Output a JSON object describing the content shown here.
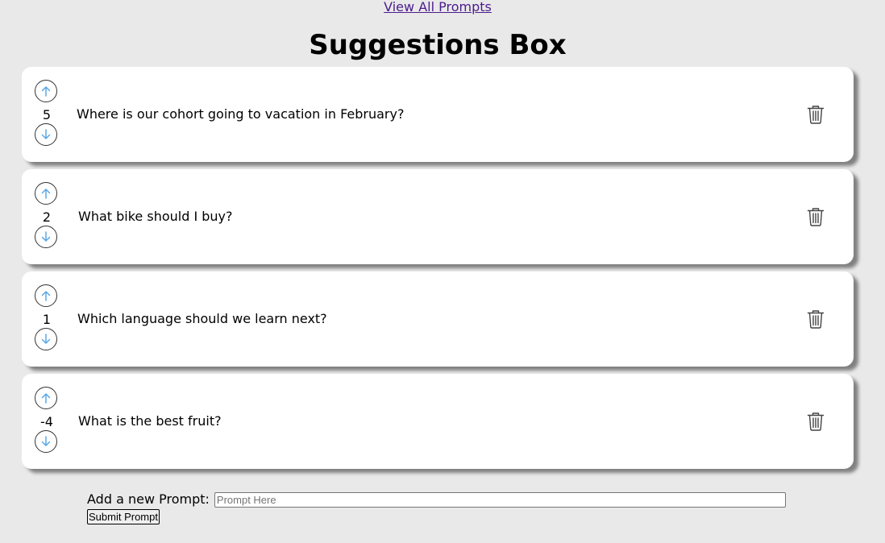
{
  "nav": {
    "view_all_label": "View All Prompts"
  },
  "header": {
    "title": "Suggestions Box"
  },
  "prompts": [
    {
      "votes": "5",
      "text": "Where is our cohort going to vacation in February?"
    },
    {
      "votes": "2",
      "text": "What bike should I buy?"
    },
    {
      "votes": "1",
      "text": "Which language should we learn next?"
    },
    {
      "votes": "-4",
      "text": "What is the best fruit?"
    }
  ],
  "icons": {
    "upvote": "arrow-up-icon",
    "downvote": "arrow-down-icon",
    "delete": "trash-icon"
  },
  "colors": {
    "arrow": "#5aa8e6",
    "background": "#e9e9e9",
    "link": "#4b1c8c"
  },
  "form": {
    "label": "Add a new Prompt:",
    "placeholder": "Prompt Here",
    "value": "",
    "submit_label": "Submit Prompt"
  }
}
